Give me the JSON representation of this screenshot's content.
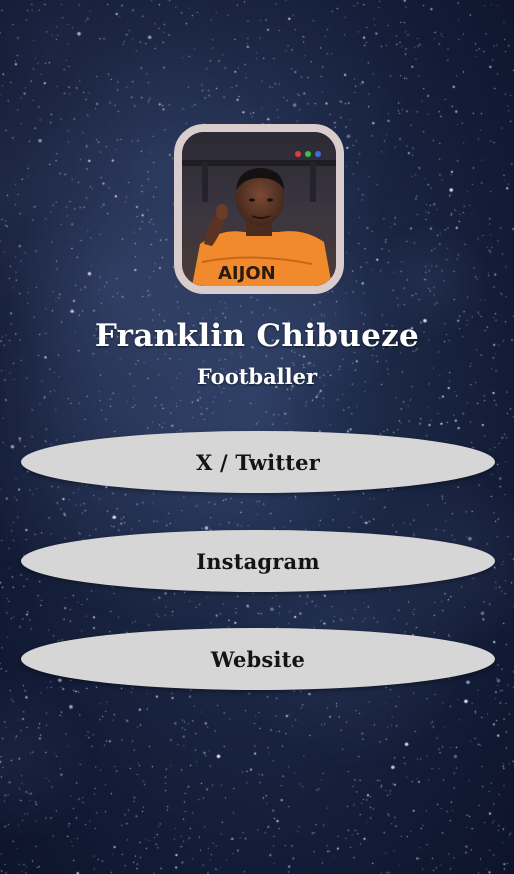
{
  "profile": {
    "name": "Franklin Chibueze",
    "role": "Footballer",
    "avatar": {
      "frame_color": "#d8cccc",
      "shirt_text": "AIJON"
    }
  },
  "links": [
    {
      "label": "X / Twitter"
    },
    {
      "label": "Instagram"
    },
    {
      "label": "Website"
    }
  ],
  "theme": {
    "background": "starry night sky",
    "button_bg": "#d6d6d6",
    "text_color": "#ffffff",
    "button_text_color": "#141414"
  }
}
